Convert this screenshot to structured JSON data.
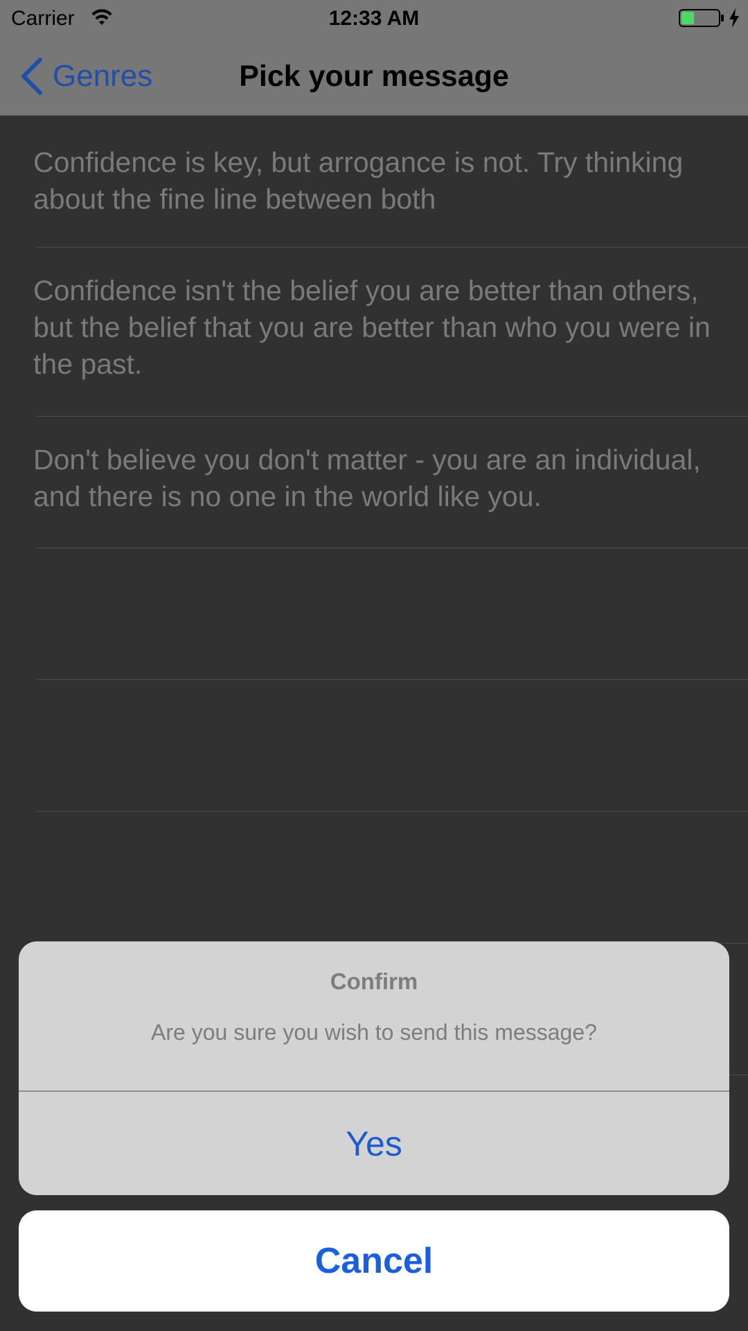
{
  "status_bar": {
    "carrier": "Carrier",
    "time": "12:33 AM",
    "icons": [
      "wifi-icon",
      "battery-icon",
      "charging-bolt-icon"
    ],
    "battery_color": "#4cd964"
  },
  "nav_bar": {
    "back_label": "Genres",
    "title": "Pick your message",
    "accent_color": "#1f4fa8"
  },
  "messages": [
    "Confidence is key, but arrogance is not. Try thinking about the fine line between both",
    "Confidence isn't the belief you are better than others, but the belief that you are better than who you were in the past.",
    "Don't believe you don't matter - you are an individual, and there is no one in the world like you.",
    "",
    "",
    "",
    ""
  ],
  "action_sheet": {
    "title": "Confirm",
    "message": "Are you sure you wish to send this message?",
    "confirm_label": "Yes",
    "cancel_label": "Cancel",
    "button_color": "#1a5fe0"
  }
}
